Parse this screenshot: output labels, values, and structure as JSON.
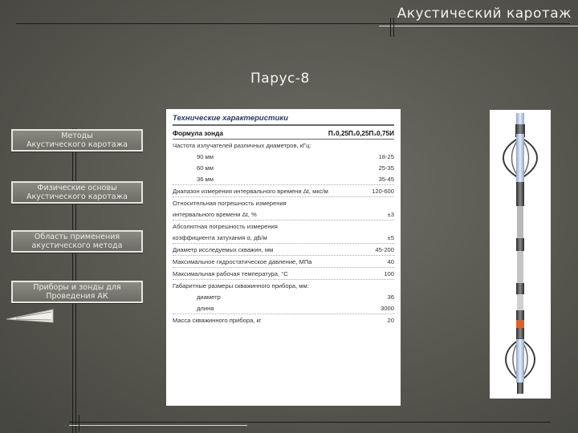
{
  "slide": {
    "title": "Акустический каротаж",
    "subtitle": "Парус-8"
  },
  "nav": {
    "items": [
      {
        "label1": "Методы",
        "label2": "Акустического каротажа"
      },
      {
        "label1": "Физические основы",
        "label2": "Акустического каротажа"
      },
      {
        "label1": "Область применения",
        "label2": "акустического метода"
      },
      {
        "label1": "Приборы и зонды для",
        "label2": "Проведения АК"
      }
    ]
  },
  "spec": {
    "heading": "Технические характеристики",
    "rows": [
      {
        "label": "Формула зонда",
        "value": "П₁0,25П₂0,25П₃0,75И"
      },
      {
        "label": "Частота излучателей различных диаметров, кГц:",
        "value": ""
      },
      {
        "label": "90 мм",
        "value": "18-25"
      },
      {
        "label": "60 мм",
        "value": "25-35"
      },
      {
        "label": "36 мм",
        "value": "35-45"
      },
      {
        "label": "Диапазон измерения интервального времени Δt, мкс/м",
        "value": "120-600"
      },
      {
        "label": "Относительная погрешность измерения",
        "value": ""
      },
      {
        "label": "интервального времени Δt, %",
        "value": "±3"
      },
      {
        "label": "Абсолютная погрешность измерения",
        "value": ""
      },
      {
        "label": "коэффициента затухания α, дБ/м",
        "value": "±5"
      },
      {
        "label": "Диаметр исследуемых скважин, мм",
        "value": "45-200"
      },
      {
        "label": "Максимальное гидростатическое давление, МПа",
        "value": "40"
      },
      {
        "label": "Максимальная рабочая температура, °С",
        "value": "100"
      },
      {
        "label": "Габаритные размеры скважинного прибора, мм:",
        "value": ""
      },
      {
        "label": "диаметр",
        "value": "36"
      },
      {
        "label": "длина",
        "value": "3000"
      },
      {
        "label": "Масса скважинного прибора, кг",
        "value": "20"
      }
    ]
  },
  "colors": {
    "background": "#5b5b53",
    "button_fill": "#7a7a72",
    "button_border": "#e6e6de",
    "tool_orange": "#e0602a",
    "tool_blue": "#c8d6ec"
  }
}
